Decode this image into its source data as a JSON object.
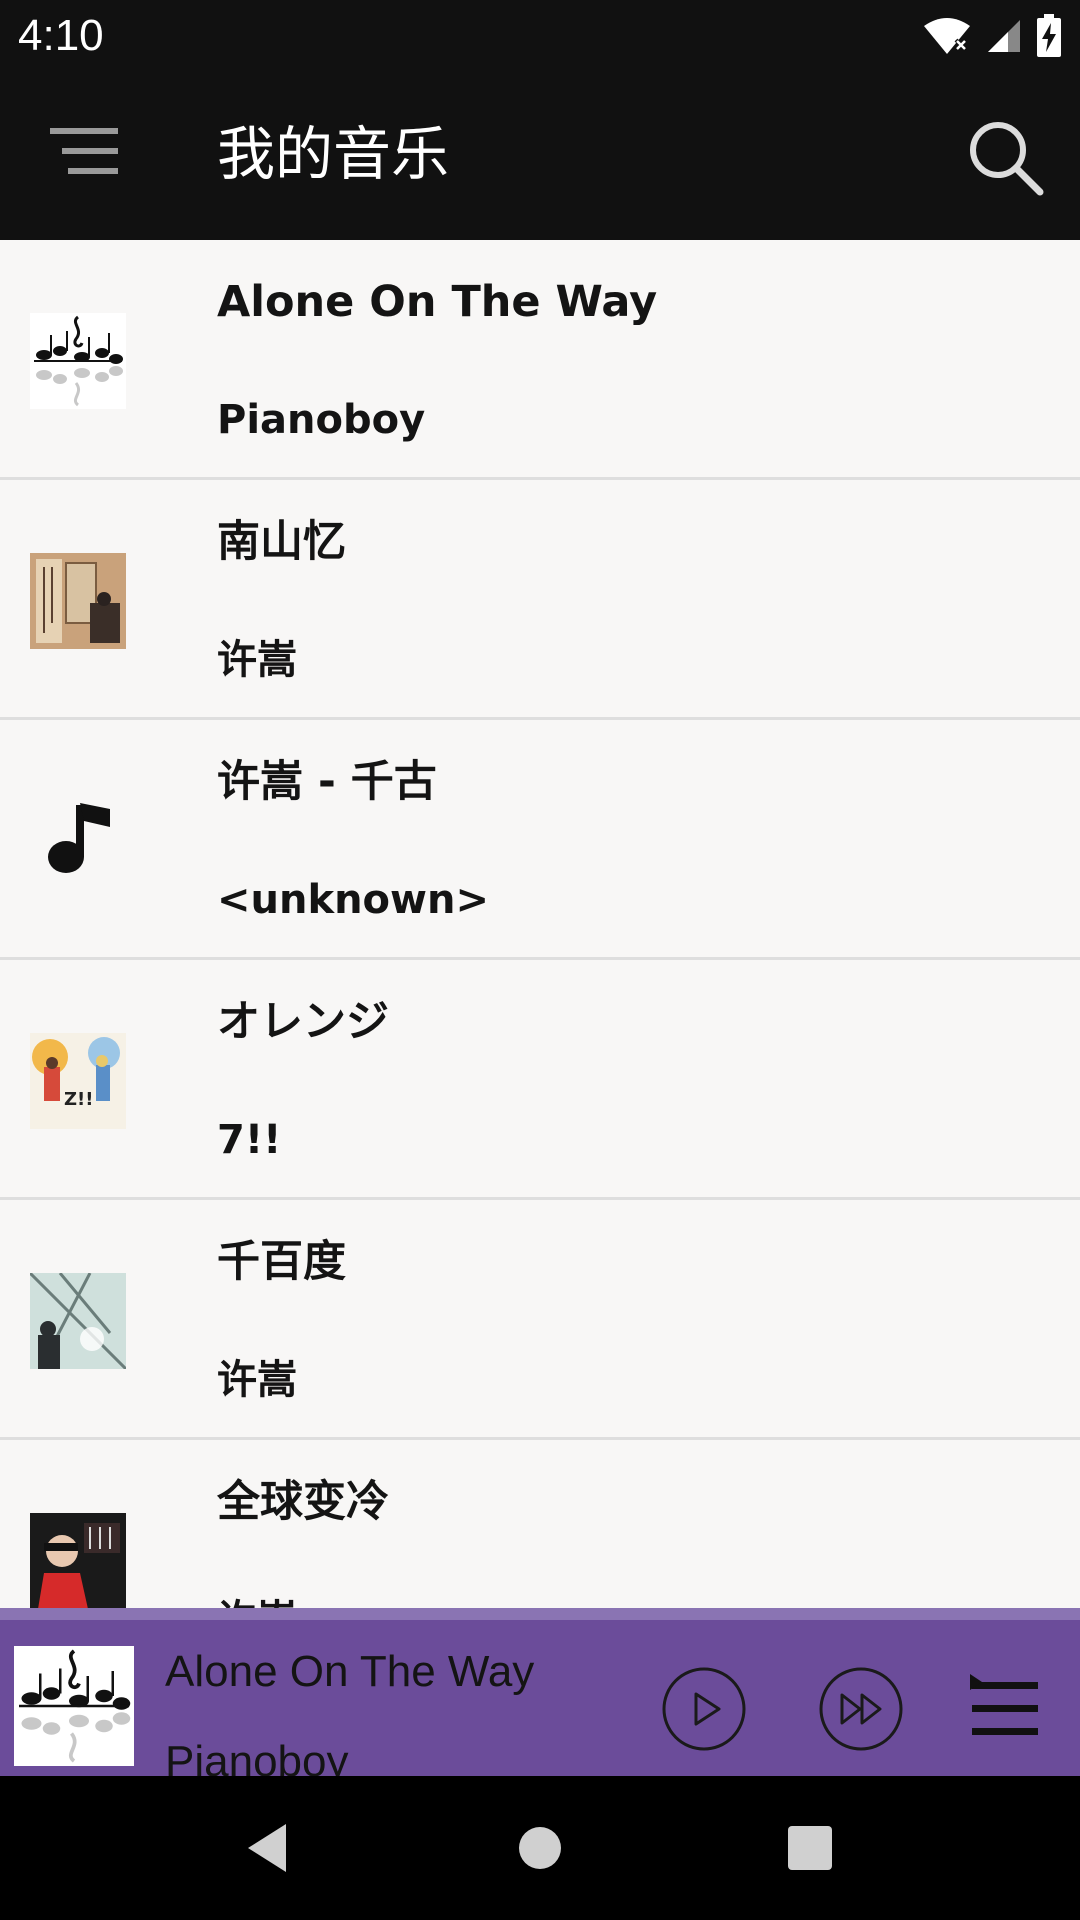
{
  "status_bar": {
    "time": "4:10",
    "icons": [
      "wifi-icon",
      "signal-icon",
      "battery-charging-icon"
    ]
  },
  "app_bar": {
    "title": "我的音乐",
    "menu_icon": "menu-icon",
    "search_icon": "search-icon"
  },
  "songs": [
    {
      "title": "Alone On The Way",
      "artist": "Pianoboy",
      "art": "sheet-music-cover"
    },
    {
      "title": "南山忆",
      "artist": "许嵩",
      "art": "album-cover-nanshan"
    },
    {
      "title": "许嵩 - 千古",
      "artist": "<unknown>",
      "art": "music-note-icon"
    },
    {
      "title": "オレンジ",
      "artist": "7!!",
      "art": "album-cover-orange"
    },
    {
      "title": "千百度",
      "artist": "许嵩",
      "art": "album-cover-qianbaidu"
    },
    {
      "title": "全球变冷",
      "artist": "许嵩",
      "art": "album-cover-quanqiu"
    }
  ],
  "now_playing": {
    "title": "Alone On The Way",
    "artist": "Pianoboy",
    "controls": [
      "play-icon",
      "skip-next-icon",
      "playlist-icon"
    ]
  },
  "colors": {
    "bar": "#111111",
    "list_bg": "#f8f7f6",
    "now_playing_bg": "#6b4c9a",
    "divider": "#dedede"
  },
  "nav_bar": {
    "icons": [
      "back-icon",
      "home-icon",
      "recents-icon"
    ]
  }
}
